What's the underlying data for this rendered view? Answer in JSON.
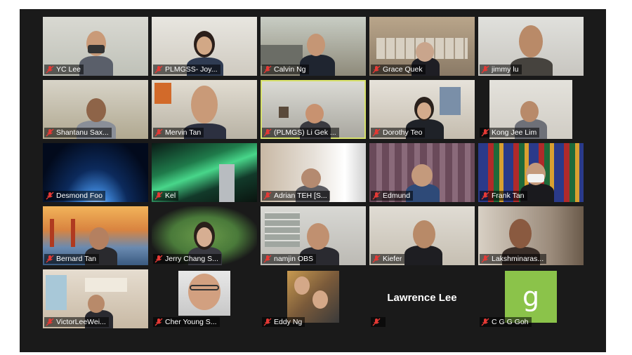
{
  "meeting": {
    "participants": [
      {
        "name": "YC Lee",
        "muted": true
      },
      {
        "name": "PLMGSS- Joy...",
        "muted": true
      },
      {
        "name": "Calvin Ng",
        "muted": true
      },
      {
        "name": "Grace Quek",
        "muted": true
      },
      {
        "name": "jimmy lu",
        "muted": true
      },
      {
        "name": "Shantanu Sax...",
        "muted": true
      },
      {
        "name": "Mervin Tan",
        "muted": true
      },
      {
        "name": "(PLMGS) Li Gek ...",
        "muted": true,
        "active_speaker": true
      },
      {
        "name": "Dorothy Teo",
        "muted": true
      },
      {
        "name": "Kong Jee Lim",
        "muted": true
      },
      {
        "name": "Desmond Foo",
        "muted": true
      },
      {
        "name": "Kel",
        "muted": true
      },
      {
        "name": "Adrian TEH [S...",
        "muted": true
      },
      {
        "name": "Edmund",
        "muted": true
      },
      {
        "name": "Frank Tan",
        "muted": true
      },
      {
        "name": "Bernard Tan",
        "muted": true
      },
      {
        "name": "Jerry Chang S...",
        "muted": true
      },
      {
        "name": "namjin OBS",
        "muted": true
      },
      {
        "name": "Kiefer",
        "muted": true
      },
      {
        "name": "Lakshminaras...",
        "muted": true
      },
      {
        "name": "VictorLeeWei...",
        "muted": true
      },
      {
        "name": "Cher Young S...",
        "muted": true
      },
      {
        "name": "Eddy Ng",
        "muted": true
      },
      {
        "name": "",
        "muted": true,
        "video_off_name": "Lawrence Lee"
      },
      {
        "name": "C G G Goh",
        "muted": true,
        "avatar_letter": "g",
        "avatar_color": "#8bc34a"
      }
    ]
  },
  "icons": {
    "mic": "mic-muted-icon"
  },
  "colors": {
    "background": "#1a1a1a",
    "active_border": "#d8e26b",
    "muted_icon": "#e53935"
  }
}
